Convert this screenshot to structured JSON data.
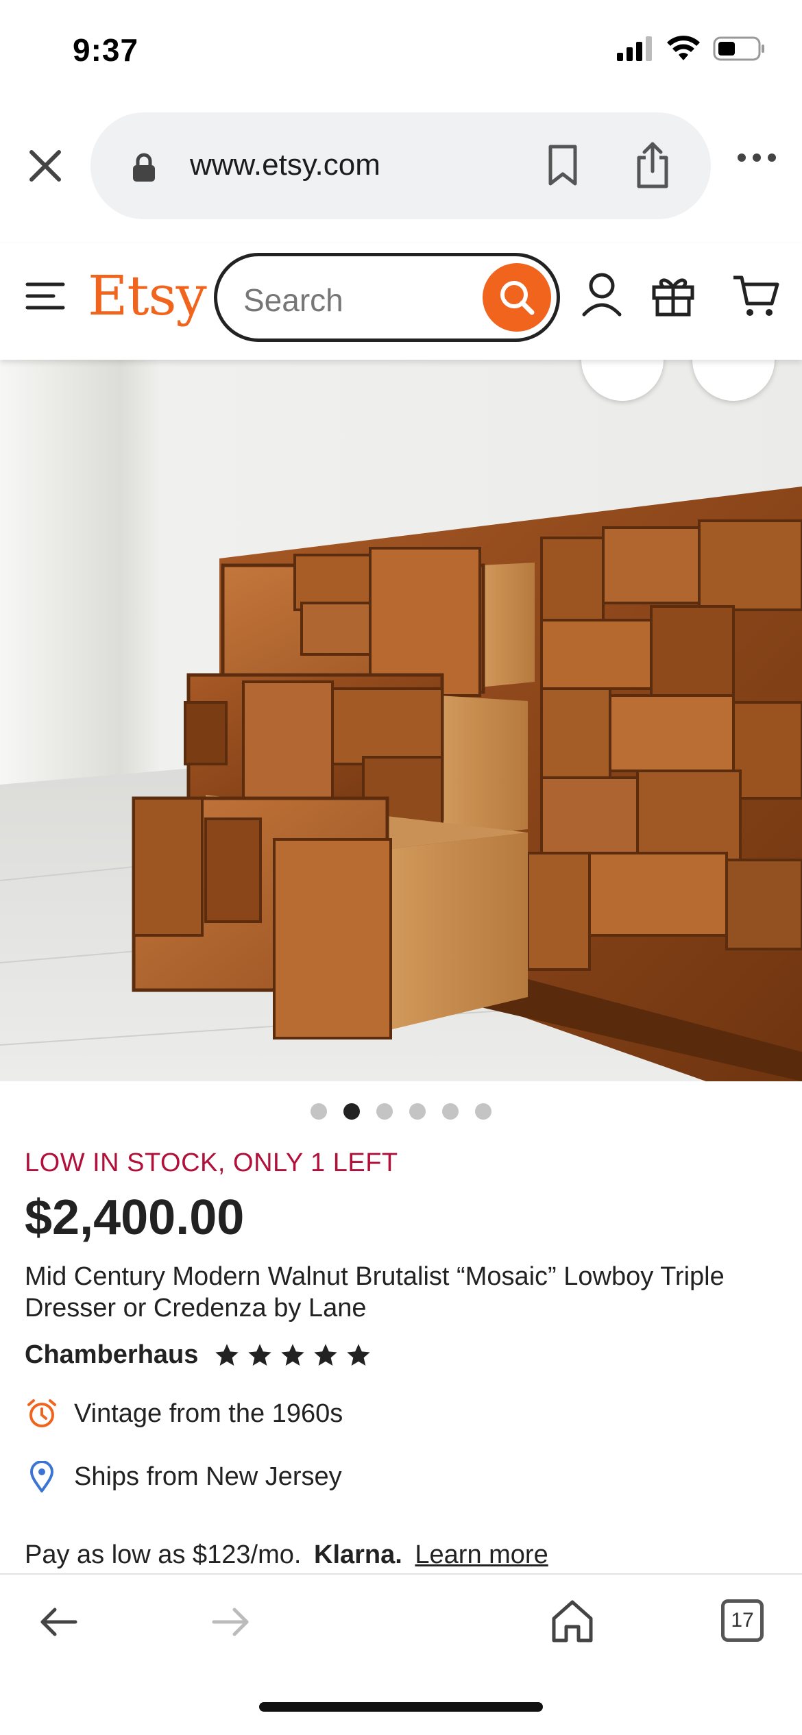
{
  "status_bar": {
    "time": "9:37"
  },
  "browser": {
    "url": "www.etsy.com",
    "tab_count": "17"
  },
  "header": {
    "logo": "Etsy",
    "search_placeholder": "Search",
    "brand_color": "#f1641e"
  },
  "product": {
    "image_count": 6,
    "active_image_index": 1,
    "stock_label": "LOW IN STOCK, ONLY 1 LEFT",
    "price": "$2,400.00",
    "title": "Mid Century Modern Walnut Brutalist “Mosaic” Lowboy Triple Dresser or Credenza by Lane",
    "shop_name": "Chamberhaus",
    "rating_stars": 5,
    "details": [
      {
        "icon": "alarm-clock-icon",
        "text": "Vintage from the 1960s"
      },
      {
        "icon": "location-pin-icon",
        "text": "Ships from New Jersey"
      }
    ],
    "payment": {
      "text": "Pay as low as $123/mo.",
      "provider": "Klarna.",
      "link": "Learn more"
    }
  },
  "colors": {
    "stock_warning": "#b0103a",
    "accent": "#f1641e",
    "location_blue": "#3b74d4"
  }
}
